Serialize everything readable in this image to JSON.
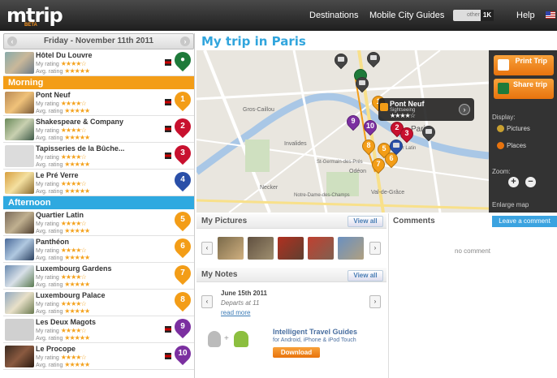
{
  "app": {
    "logo": "mtrip",
    "badge": "BETA"
  },
  "nav": {
    "destinations": "Destinations",
    "guides": "Mobile City Guides",
    "toggle_off": "other",
    "toggle_on": "1K",
    "help": "Help"
  },
  "day": {
    "date": "Friday - November 11th 2011"
  },
  "hotel": {
    "name": "Hôtel Du Louvre",
    "rating_label": "My rating",
    "avg_label": "Avg. rating"
  },
  "sections": {
    "morning": "Morning",
    "afternoon": "Afternoon"
  },
  "morning_items": [
    {
      "name": "Pont Neuf",
      "num": "1"
    },
    {
      "name": "Shakespeare & Company",
      "num": "2"
    },
    {
      "name": "Tapisseries de la Bûche...",
      "num": "3"
    },
    {
      "name": "Le Pré Verre",
      "num": "4"
    }
  ],
  "afternoon_items": [
    {
      "name": "Quartier Latin",
      "num": "5"
    },
    {
      "name": "Panthéon",
      "num": "6"
    },
    {
      "name": "Luxembourg Gardens",
      "num": "7"
    },
    {
      "name": "Luxembourg Palace",
      "num": "8"
    },
    {
      "name": "Les Deux Magots",
      "num": "9"
    },
    {
      "name": "Le Procope",
      "num": "10"
    }
  ],
  "labels": {
    "my_rating": "My rating",
    "avg_rating": "Avg. rating",
    "stars_full": "★★★★☆",
    "stars_avg": "★★★★★"
  },
  "main": {
    "title": "My trip in Paris"
  },
  "map": {
    "labels": [
      "Gros-Caillou",
      "Invalides",
      "St-Germain-des-Prés",
      "Odéon",
      "Val-de-Grâce",
      "Notre-Dame-des-Champs",
      "Necker",
      "Paris",
      "Quartier Latin"
    ],
    "popup_name": "Pont Neuf",
    "popup_cat": "Sightseeing",
    "popup_stars": "★★★★☆"
  },
  "actions": {
    "print": "Print Trip",
    "share": "Share trip"
  },
  "sidebar": {
    "display": "Display:",
    "pictures": "Pictures",
    "places": "Places",
    "zoom": "Zoom:",
    "enlarge": "Enlarge map"
  },
  "pictures": {
    "title": "My Pictures",
    "view_all": "View all"
  },
  "notes": {
    "title": "My Notes",
    "view_all": "View all",
    "date": "June 15th 2011",
    "text": "Departs at 11",
    "read_more": "read more"
  },
  "comments": {
    "title": "Comments",
    "leave": "Leave a comment",
    "empty": "no comment"
  },
  "promo": {
    "title": "Intelligent Travel Guides",
    "sub1": "for Android, iPhone & iPod Touch",
    "download": "Download"
  },
  "colors": {
    "orange": "#f39d17",
    "blue": "#2fa9e0",
    "red": "#c8102e",
    "purple": "#7b2fa0",
    "navy": "#2a4fa8",
    "green": "#1e7a3a"
  }
}
